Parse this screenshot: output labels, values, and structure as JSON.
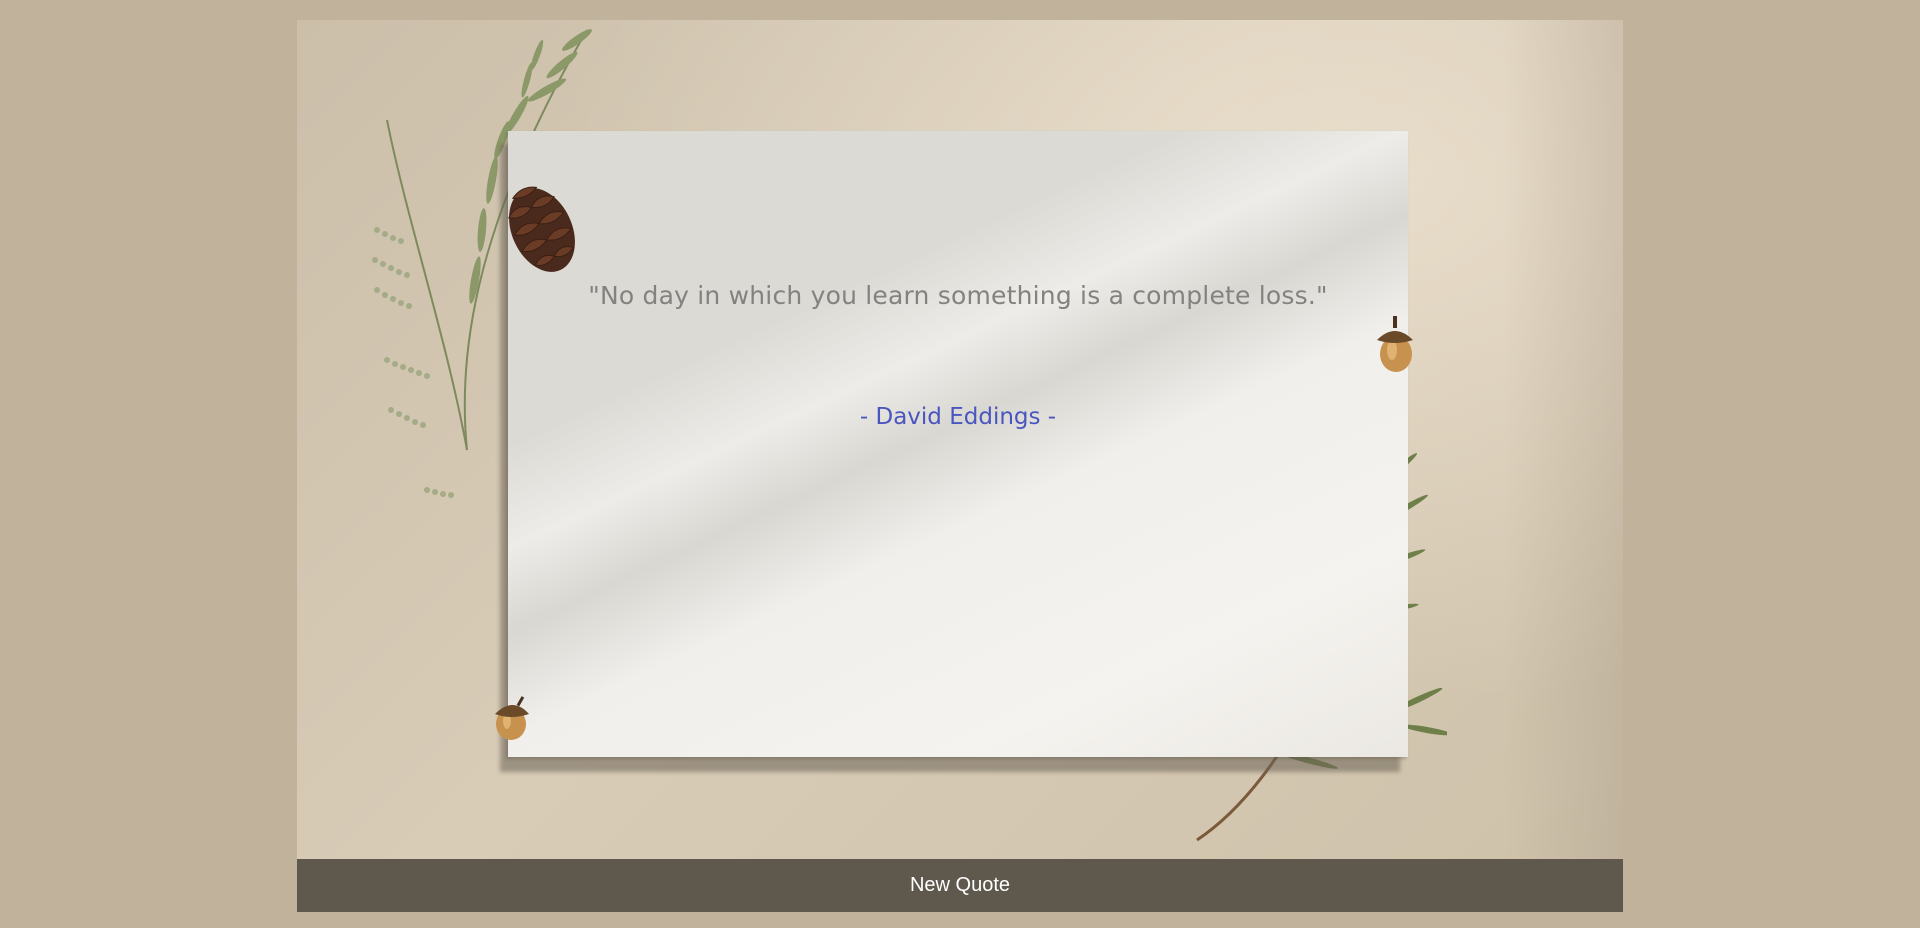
{
  "quote": {
    "text": "\"No day in which you learn something is a complete loss.\"",
    "author": "- David Eddings -"
  },
  "controls": {
    "new_quote_label": "New Quote"
  },
  "colors": {
    "page_background": "#c0b29b",
    "button_background": "#5f584c",
    "quote_text": "#848280",
    "author_text": "#4a56bf"
  },
  "decorations": [
    "fern-branch-icon",
    "pine-branch-icon",
    "pinecone-icon",
    "acorn-icon"
  ]
}
